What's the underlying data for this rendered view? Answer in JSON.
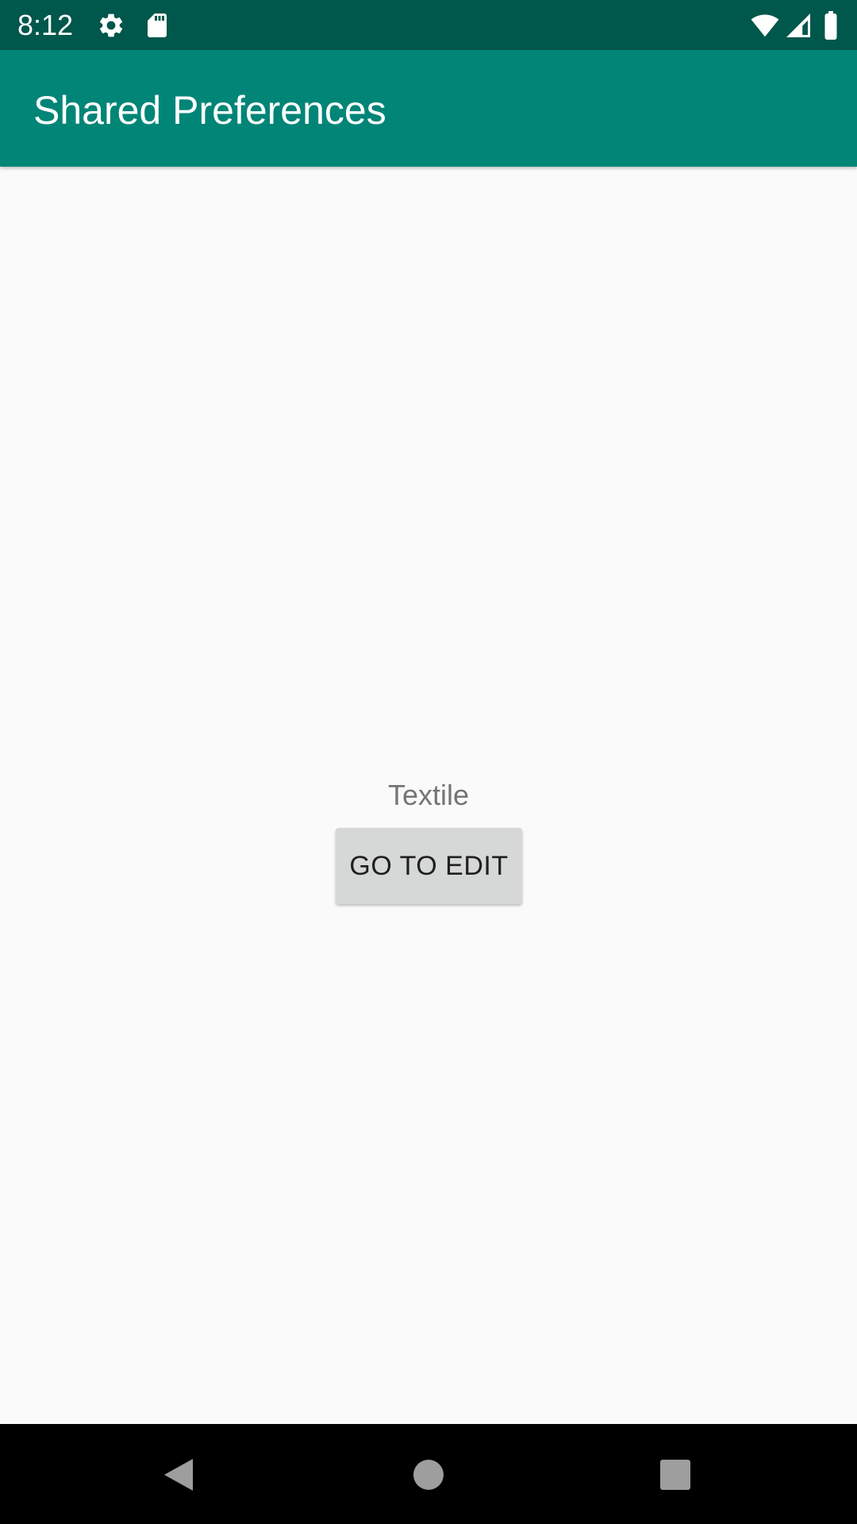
{
  "status_bar": {
    "time": "8:12",
    "icons": [
      "gear-icon",
      "sd-card-icon",
      "wifi-icon",
      "signal-icon",
      "battery-icon"
    ],
    "background": "#00574b"
  },
  "app_bar": {
    "title": "Shared Preferences",
    "background": "#008577"
  },
  "main": {
    "stored_value": "Textile",
    "edit_button_label": "GO TO EDIT"
  },
  "nav_bar": {
    "icons": [
      "back-icon",
      "home-icon",
      "recents-icon"
    ]
  }
}
